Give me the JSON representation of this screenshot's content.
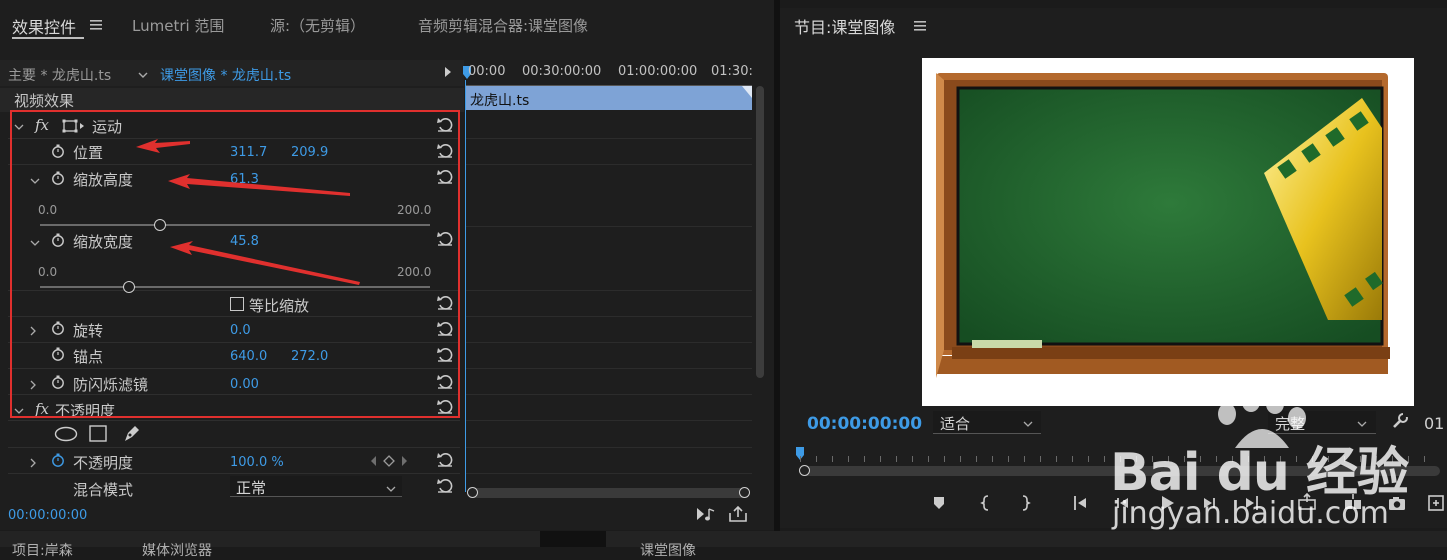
{
  "left_tabs": {
    "effect_controls": "效果控件",
    "lumetri": "Lumetri 范围",
    "source": "源:（无剪辑）",
    "mixer": "音频剪辑混合器:课堂图像"
  },
  "clip_header": {
    "master": "主要 * 龙虎山.ts",
    "sequence": "课堂图像 * 龙虎山.ts"
  },
  "timeline": {
    "ruler": [
      "00:00",
      "00:30:00:00",
      "01:00:00:00",
      "01:30:0"
    ],
    "clip_name": "龙虎山.ts"
  },
  "effects": {
    "section": "视频效果",
    "fx": "fx",
    "motion": "运动",
    "position": {
      "label": "位置",
      "x": "311.7",
      "y": "209.9"
    },
    "scale_height": {
      "label": "缩放高度",
      "value": "61.3",
      "min": "0.0",
      "max": "200.0",
      "level": 61.3
    },
    "scale_width": {
      "label": "缩放宽度",
      "value": "45.8",
      "min": "0.0",
      "max": "200.0",
      "level": 45.8
    },
    "uniform": "等比缩放",
    "rotation": {
      "label": "旋转",
      "value": "0.0"
    },
    "anchor": {
      "label": "锚点",
      "x": "640.0",
      "y": "272.0"
    },
    "flicker": {
      "label": "防闪烁滤镜",
      "value": "0.00"
    },
    "opacity_section": "不透明度",
    "opacity": {
      "label": "不透明度",
      "value": "100.0 %"
    },
    "blend": {
      "label": "混合模式",
      "value": "正常"
    },
    "timecode": "00:00:00:00"
  },
  "program": {
    "title": "节目:课堂图像",
    "timecode": "00:00:00:00",
    "fit": "适合",
    "quality": "完整",
    "page_hint": "01"
  },
  "bottom_tabs": {
    "project": "项目:岸森",
    "media": "媒体浏览器",
    "seq": "课堂图像"
  },
  "watermark": {
    "brand": "Bai du 经验",
    "url": "jingyan.baidu.com"
  },
  "colors": {
    "accent": "#3e9be6",
    "highlight": "#e0302e",
    "clip": "#7ea3d6"
  }
}
